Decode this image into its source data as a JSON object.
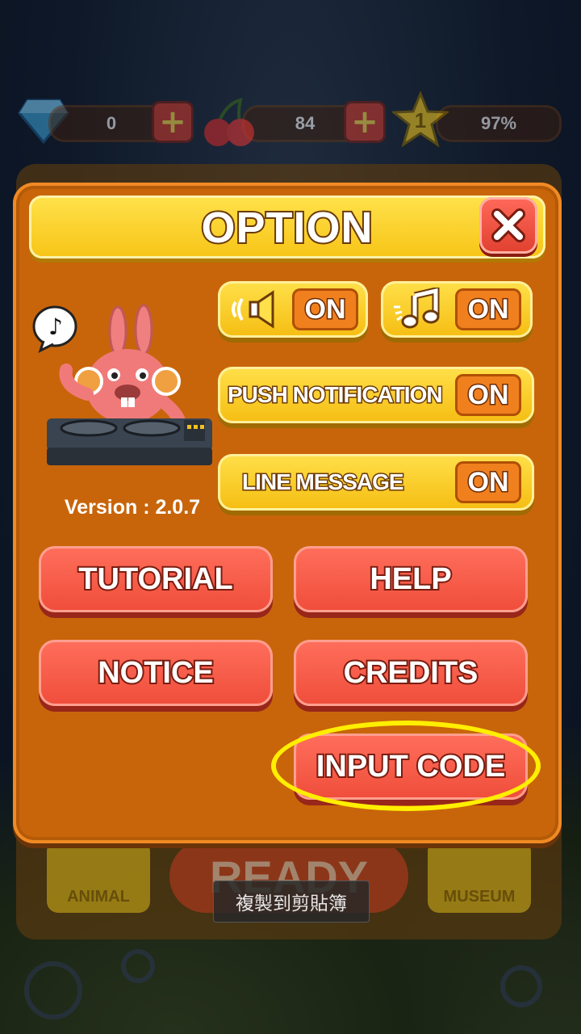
{
  "hud": {
    "diamonds": "0",
    "cherries": "84",
    "level": "1",
    "progress": "97%"
  },
  "dialog": {
    "title": "OPTION",
    "version": "Version : 2.0.7",
    "toggles": {
      "sound_state": "ON",
      "music_state": "ON",
      "push_label": "PUSH NOTIFICATION",
      "push_state": "ON",
      "line_label": "LINE MESSAGE",
      "line_state": "ON"
    },
    "buttons": {
      "tutorial": "TUTORIAL",
      "help": "HELP",
      "notice": "NOTICE",
      "credits": "CREDITS",
      "input_code": "INPUT CODE"
    }
  },
  "background": {
    "animal_label": "ANIMAL",
    "ready_label": "READY",
    "museum_label": "MUSEUM"
  },
  "toast": "複製到剪貼簿",
  "colors": {
    "dialog_bg": "#c8650a",
    "title_yellow": "#f7c416",
    "button_red": "#ef4d3a",
    "highlight": "#ffee00"
  }
}
